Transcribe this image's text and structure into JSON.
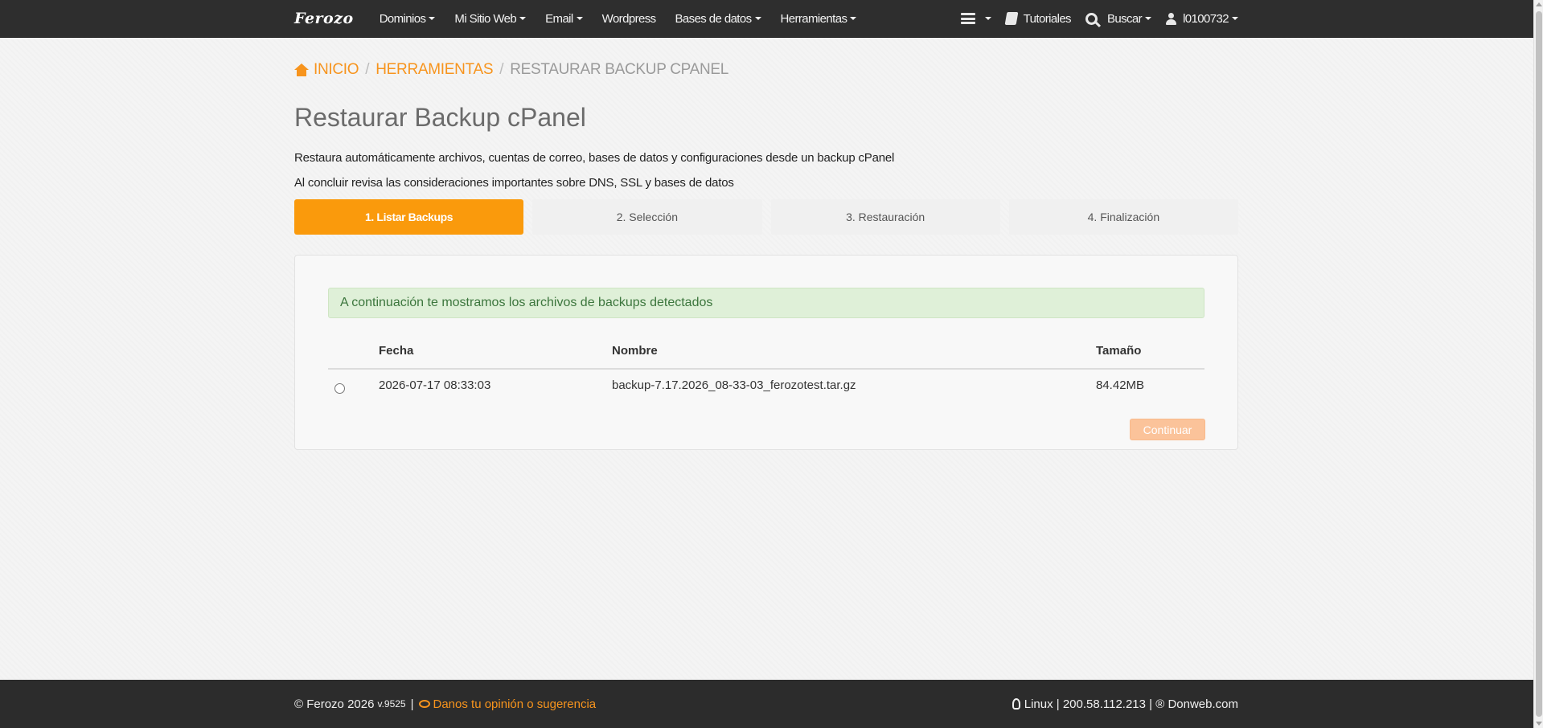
{
  "navbar": {
    "brand": "Ferozo",
    "menu": [
      {
        "label": "Dominios",
        "dropdown": true
      },
      {
        "label": "Mi Sitio Web",
        "dropdown": true
      },
      {
        "label": "Email",
        "dropdown": true
      },
      {
        "label": "Wordpress",
        "dropdown": false
      },
      {
        "label": "Bases de datos",
        "dropdown": true
      },
      {
        "label": "Herramientas",
        "dropdown": true
      }
    ],
    "right": {
      "server_icon": "server-icon",
      "tutoriales": "Tutoriales",
      "buscar": "Buscar",
      "user": "l0100732"
    }
  },
  "breadcrumb": {
    "home": "INICIO",
    "tools": "HERRAMIENTAS",
    "current": "RESTAURAR BACKUP CPANEL"
  },
  "page": {
    "title": "Restaurar Backup cPanel",
    "description_1": "Restaura automáticamente archivos, cuentas de correo, bases de datos y configuraciones desde un backup cPanel",
    "description_2": "Al concluir revisa las consideraciones importantes sobre DNS, SSL y bases de datos"
  },
  "steps": [
    {
      "label": "1. Listar Backups",
      "active": true
    },
    {
      "label": "2. Selección",
      "active": false
    },
    {
      "label": "3. Restauración",
      "active": false
    },
    {
      "label": "4. Finalización",
      "active": false
    }
  ],
  "panel": {
    "alert": "A continuación te mostramos los archivos de backups detectados",
    "table": {
      "headers": {
        "fecha": "Fecha",
        "nombre": "Nombre",
        "tamano": "Tamaño"
      },
      "rows": [
        {
          "fecha": "2026-07-17 08:33:03",
          "nombre": "backup-7.17.2026_08-33-03_ferozotest.tar.gz",
          "tamano": "84.42MB",
          "selected": false
        }
      ]
    },
    "continue_label": "Continuar"
  },
  "footer": {
    "copyright": "© Ferozo 2026",
    "version": "v.9525",
    "feedback": "Danos tu opinión o sugerencia",
    "server_info": "Linux | 200.58.112.213 | ® Donweb.com"
  },
  "colors": {
    "accent": "#f7941d",
    "step_active": "#fa9a0c",
    "navbar": "#2e2e2e",
    "alert_bg": "#dff0d8",
    "alert_text": "#3c763d"
  }
}
